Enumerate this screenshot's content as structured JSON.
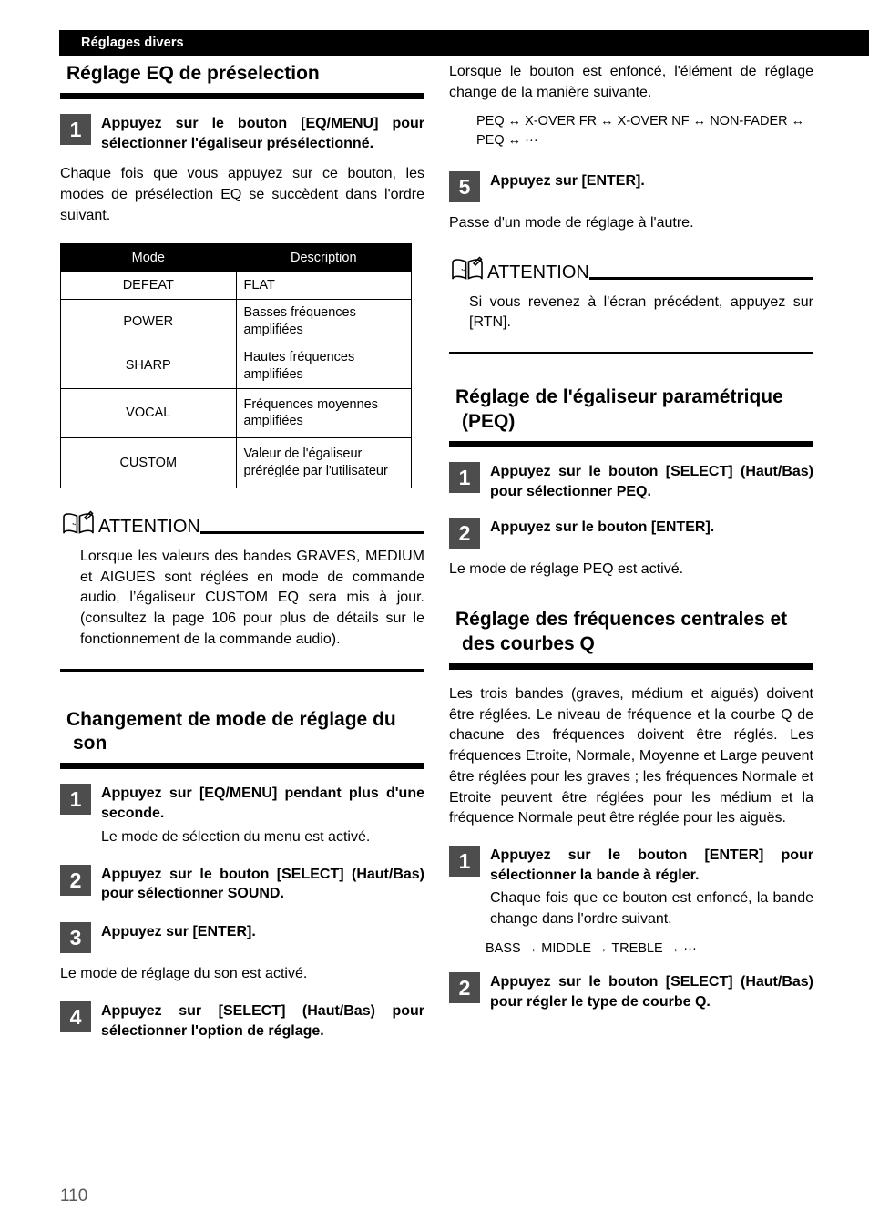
{
  "running_head": {
    "label": "Réglages divers"
  },
  "folio": {
    "page_number": "110"
  },
  "left_column": {
    "section1": {
      "heading": "Réglage EQ de préselection",
      "step1": {
        "number": "1",
        "title": "Appuyez sur le bouton [EQ/MENU] pour sélectionner l'égaliseur présélectionné.",
        "note": "Chaque fois que vous appuyez sur ce bouton, les modes de présélection EQ se succèdent dans l'ordre suivant."
      },
      "table": {
        "headers": [
          "Mode",
          "Description"
        ],
        "rows": [
          {
            "mode": "DEFEAT",
            "description": "FLAT"
          },
          {
            "mode": "POWER",
            "description": "Basses fréquences amplifiées"
          },
          {
            "mode": "SHARP",
            "description": "Hautes fréquences amplifiées"
          },
          {
            "mode": "VOCAL",
            "description": "Fréquences moyennes amplifiées"
          },
          {
            "mode": "CUSTOM",
            "description": "Valeur de l'égaliseur préréglée par l'utilisateur"
          }
        ]
      },
      "attention": {
        "title": "ATTENTION",
        "body": "Lorsque les valeurs des bandes GRAVES, MEDIUM et AIGUES sont réglées en mode de commande audio, l’égaliseur CUSTOM EQ sera mis à jour. (consultez la page 106 pour plus de détails sur le fonctionnement de la commande audio)."
      }
    },
    "section2": {
      "heading": "Changement de mode de réglage du son",
      "step1": {
        "number": "1",
        "title": "Appuyez sur [EQ/MENU] pendant plus d'une seconde.",
        "note": "Le mode de sélection du menu est activé."
      },
      "step2": {
        "number": "2",
        "title": "Appuyez sur le bouton [SELECT] (Haut/Bas) pour sélectionner SOUND."
      },
      "step3": {
        "number": "3",
        "title": "Appuyez sur [ENTER].",
        "note": "Le mode de réglage du son est activé."
      },
      "step4": {
        "number": "4",
        "title": "Appuyez sur [SELECT] (Haut/Bas) pour sélectionner l'option de réglage."
      }
    }
  },
  "right_column": {
    "continuation": {
      "note": "Lorsque le bouton est enfoncé, l'élément de réglage change de la manière suivante.",
      "flow": "PEQ ↔ X-OVER FR ↔ X-OVER NF ↔ NON-FADER ↔ PEQ ↔ ···"
    },
    "step5": {
      "number": "5",
      "title": "Appuyez sur [ENTER].",
      "note": "Passe d'un mode de réglage à l'autre."
    },
    "attention": {
      "title": "ATTENTION",
      "body": "Si vous revenez à l'écran précédent, appuyez sur [RTN]."
    },
    "section3": {
      "heading": "Réglage de l'égaliseur paramétrique (PEQ)",
      "step1": {
        "number": "1",
        "title": "Appuyez sur le bouton [SELECT] (Haut/Bas) pour sélectionner PEQ."
      },
      "step2": {
        "number": "2",
        "title": "Appuyez sur le bouton [ENTER].",
        "note": "Le mode de réglage PEQ est activé."
      }
    },
    "section4": {
      "heading": "Réglage des fréquences centrales et des courbes Q",
      "intro": "Les trois bandes (graves, médium et aiguës) doivent être réglées. Le niveau de fréquence et la courbe Q de chacune des fréquences doivent être réglés. Les fréquences Etroite, Normale, Moyenne et Large peuvent être réglées pour les graves ; les fréquences Normale et Etroite peuvent être réglées pour les médium et la fréquence Normale peut être réglée pour les aiguës.",
      "step1": {
        "number": "1",
        "title": "Appuyez sur le bouton [ENTER] pour sélectionner la bande à régler.",
        "note": "Chaque fois que ce bouton est enfoncé, la bande change dans l'ordre suivant.",
        "flow": "BASS → MIDDLE → TREBLE → ···"
      },
      "step2": {
        "number": "2",
        "title": "Appuyez sur le bouton [SELECT] (Haut/Bas) pour régler le type de courbe Q."
      }
    }
  }
}
